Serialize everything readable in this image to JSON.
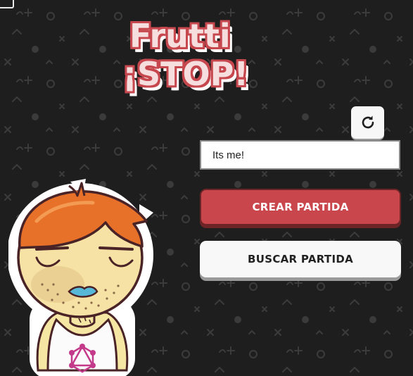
{
  "logo": {
    "line1": "Frutti",
    "line2": "¡STOP!"
  },
  "player": {
    "name_value": "Its me!"
  },
  "actions": {
    "create_label": "CREAR PARTIDA",
    "search_label": "BUSCAR PARTIDA"
  },
  "icons": {
    "refresh": "refresh-icon"
  },
  "colors": {
    "background": "#1f1e1f",
    "accent": "#c9474c",
    "logo_fill": "#f7dede"
  }
}
